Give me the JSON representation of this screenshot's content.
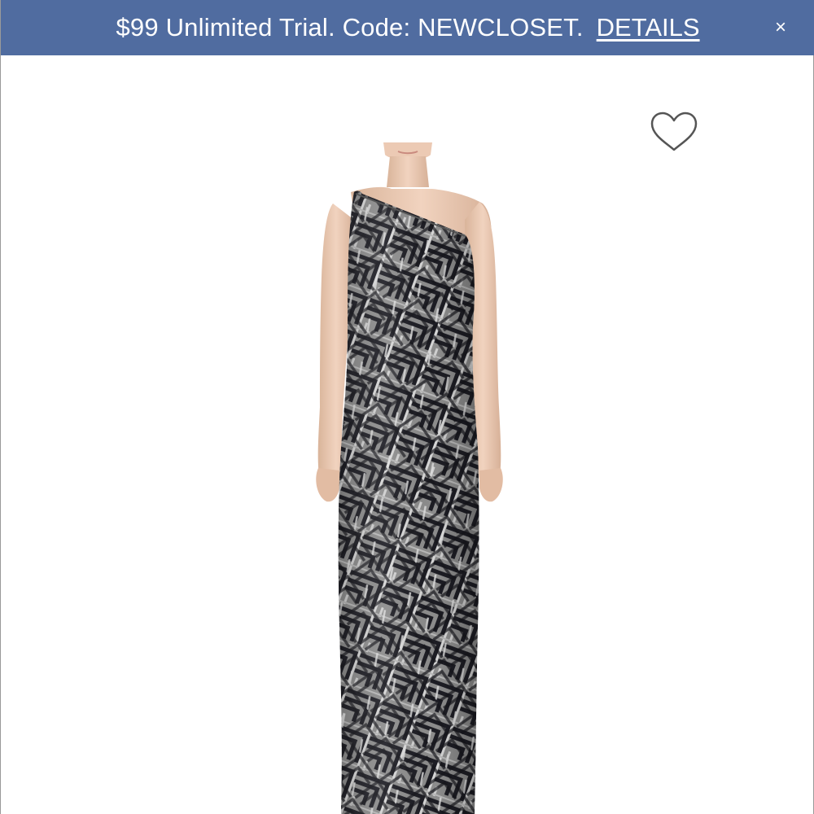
{
  "promo_banner": {
    "text": "$99 Unlimited Trial. Code: NEWCLOSET.",
    "details_link": "DETAILS",
    "close_glyph": "×",
    "background_color": "#506ca0",
    "text_color": "#ffffff"
  },
  "product": {
    "image_icon": "dress-photo",
    "favorite_icon": "heart-outline-icon",
    "dress_colors": [
      "#8a8a8a",
      "#1c1c22",
      "#c9c9c9"
    ]
  }
}
